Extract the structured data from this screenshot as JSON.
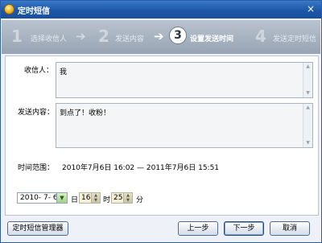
{
  "window": {
    "title": "定时短信",
    "close": "×"
  },
  "steps": [
    {
      "num": "1",
      "label": "选择收信人",
      "active": false
    },
    {
      "num": "2",
      "label": "发送内容",
      "active": false
    },
    {
      "num": "3",
      "label": "设置发送时间",
      "active": true
    },
    {
      "num": "4",
      "label": "发送定时短信",
      "active": false
    }
  ],
  "form": {
    "recipient_label": "收信人：",
    "recipient_value": "我",
    "content_label": "发送内容：",
    "content_value": "到点了！收粉！",
    "range_label": "时间范围：",
    "range_value": "2010年7月6日 16:02 — 2011年7月6日 15:51"
  },
  "schedule": {
    "date": "2010- 7- 6",
    "day_unit": "日",
    "hour": "16",
    "hour_unit": "时",
    "minute": "25",
    "minute_unit": "分"
  },
  "buttons": {
    "manager": "定时短信管理器",
    "prev": "上一步",
    "next": "下一步",
    "cancel": "取消"
  }
}
